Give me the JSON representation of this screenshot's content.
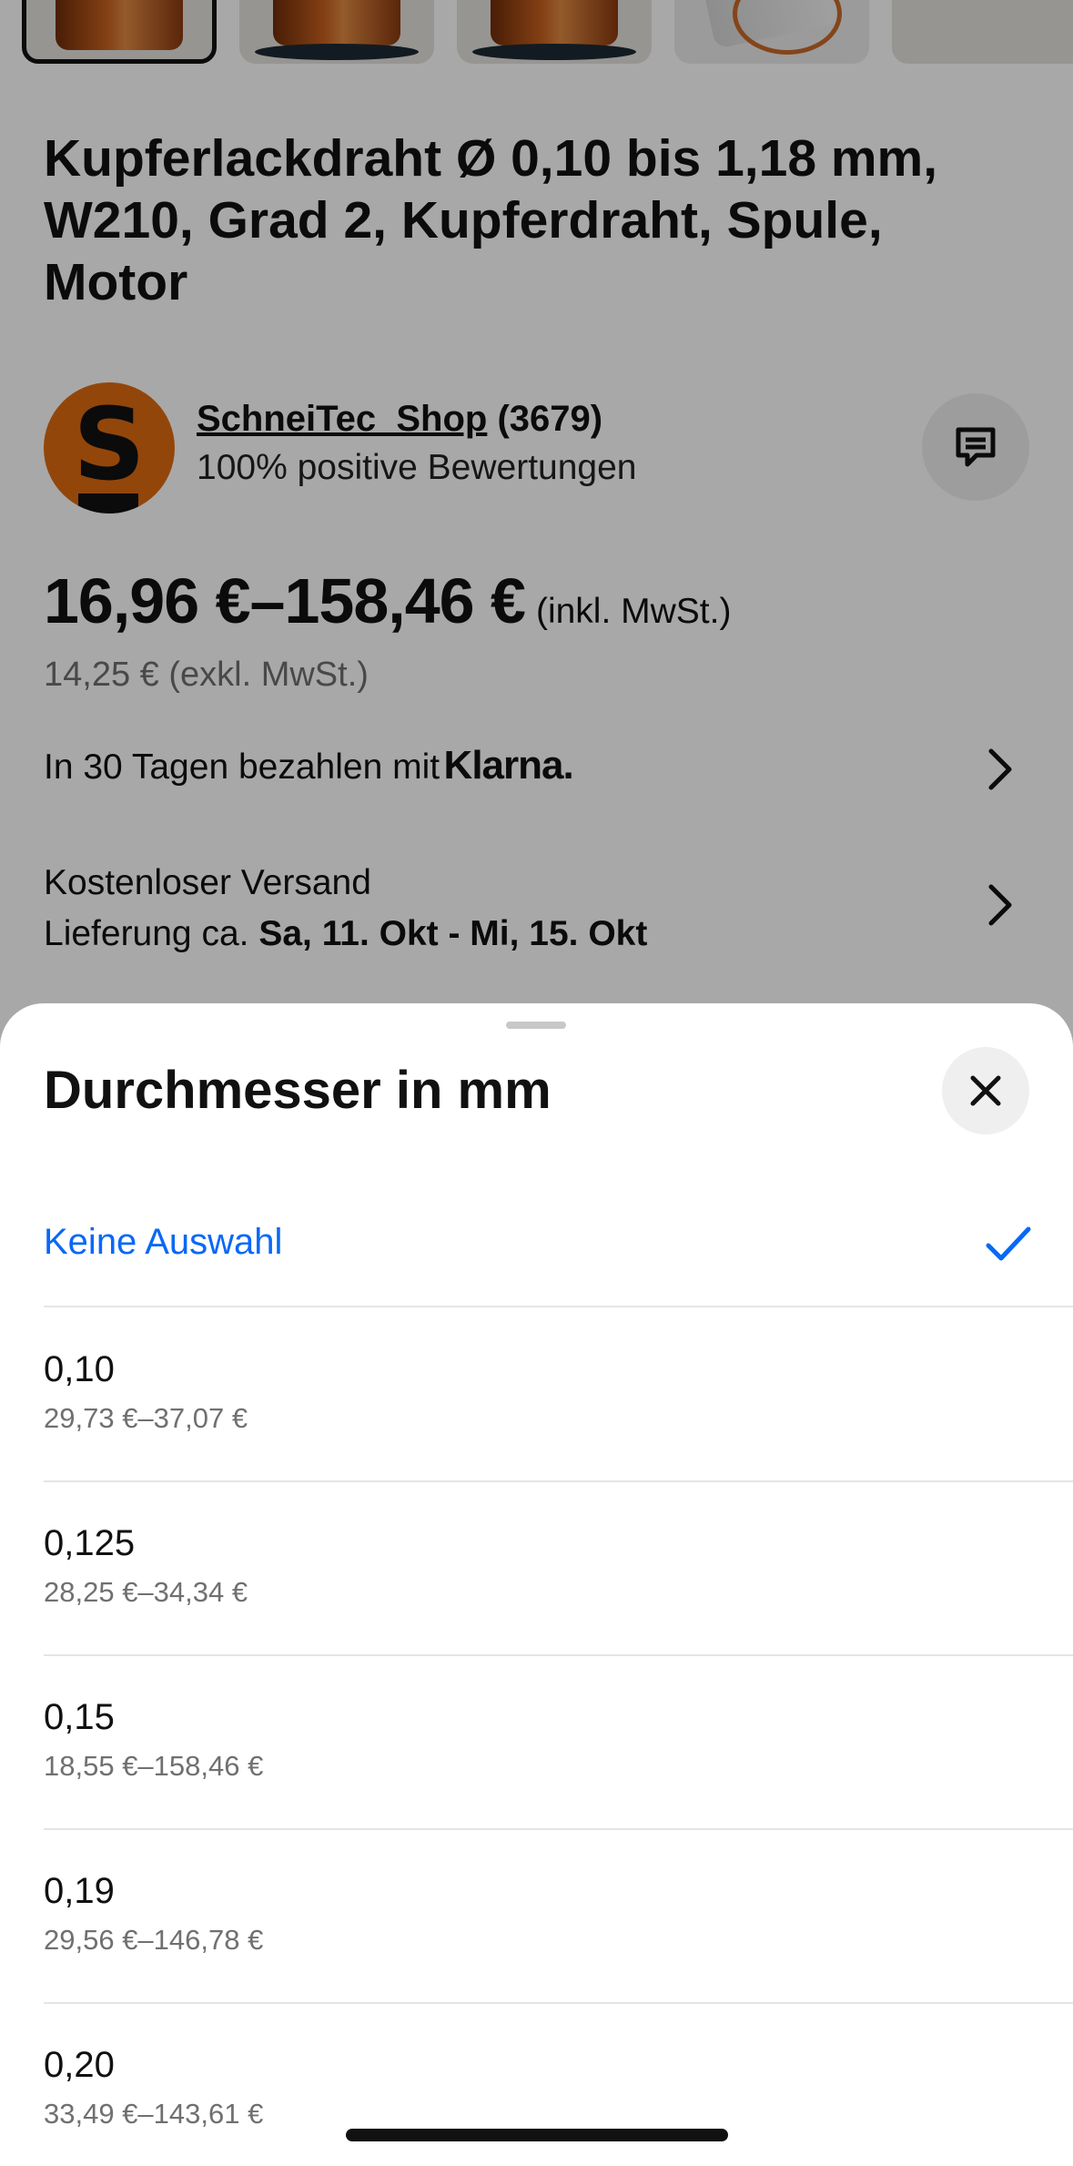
{
  "product": {
    "title": "Kupferlackdraht Ø 0,10 bis 1,18 mm, W210, Grad 2, Kupferdraht, Spule, Motor"
  },
  "seller": {
    "logo_letter": "S",
    "name": "SchneiTec_Shop",
    "count": "(3679)",
    "rating": "100% positive Bewertungen",
    "message_icon": "message-icon"
  },
  "price": {
    "range": "16,96 €–158,46 €",
    "incl_note": "(inkl. MwSt.)",
    "net": "14,25 € (exkl. MwSt.)"
  },
  "klarna": {
    "text": "In 30 Tagen bezahlen mit",
    "brand": "Klarna."
  },
  "shipping": {
    "line1": "Kostenloser Versand",
    "line2_prefix": "Lieferung ca.",
    "line2_dates": "Sa, 11. Okt - Mi, 15. Okt"
  },
  "sheet": {
    "title": "Durchmesser in mm",
    "close_icon": "close-icon",
    "none_option": "Keine Auswahl",
    "none_selected": true,
    "options": [
      {
        "value": "0,10",
        "range": "29,73 €–37,07 €"
      },
      {
        "value": "0,125",
        "range": "28,25 €–34,34 €"
      },
      {
        "value": "0,15",
        "range": "18,55 €–158,46 €"
      },
      {
        "value": "0,19",
        "range": "29,56 €–146,78 €"
      },
      {
        "value": "0,20",
        "range": "33,49 €–143,61 €"
      }
    ]
  },
  "colors": {
    "accent": "#0968f6",
    "scrim": "rgba(0,0,0,0.34)",
    "seller_logo": "#e06b10"
  }
}
